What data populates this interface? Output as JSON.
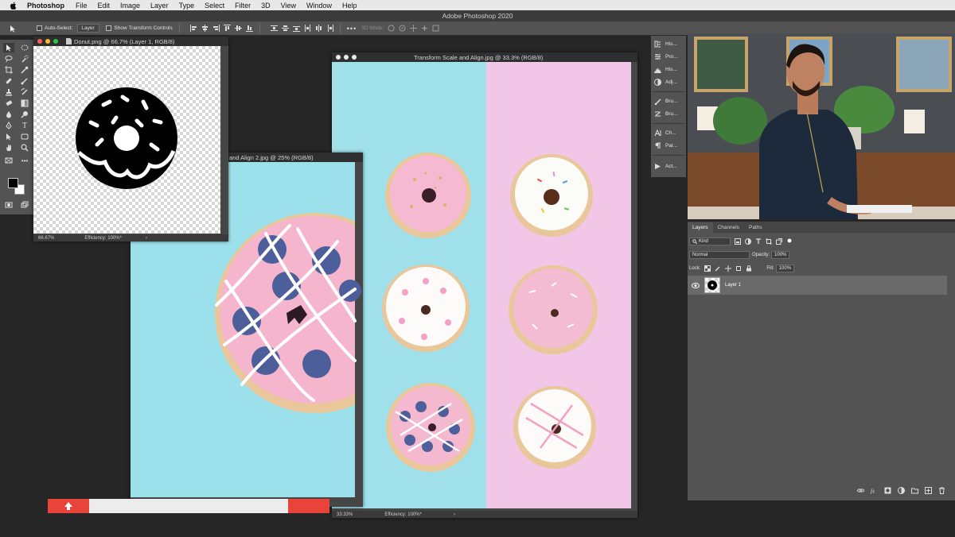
{
  "menubar": {
    "app_name": "Photoshop",
    "items": [
      "File",
      "Edit",
      "Image",
      "Layer",
      "Type",
      "Select",
      "Filter",
      "3D",
      "View",
      "Window",
      "Help"
    ]
  },
  "window_title": "Adobe Photoshop 2020",
  "options_bar": {
    "auto_select_label": "Auto-Select:",
    "auto_select_value": "Layer",
    "transform_controls_label": "Show Transform Controls",
    "threed_mode_label": "3D Mode:"
  },
  "documents": {
    "donut": {
      "title": "Donut.png @ 66.7% (Layer 1, RGB/8)",
      "zoom": "66.67%",
      "efficiency": "Efficiency: 100%*"
    },
    "align2": {
      "title": "and Align 2.jpg @ 25% (RGB/8)"
    },
    "transform": {
      "title": "Transform Scale and Align.jpg @ 33.3% (RGB/8)",
      "zoom": "33.33%",
      "efficiency": "Efficiency: 100%*"
    }
  },
  "mini_panel": {
    "items": [
      {
        "label": "His...",
        "icon": "history-icon"
      },
      {
        "label": "Pro...",
        "icon": "properties-icon"
      },
      {
        "label": "His...",
        "icon": "histogram-icon"
      },
      {
        "label": "Adj...",
        "icon": "adjustments-icon"
      },
      {
        "label": "Bru...",
        "icon": "brush-icon"
      },
      {
        "label": "Bru...",
        "icon": "brush-settings-icon"
      },
      {
        "label": "Ch...",
        "icon": "character-icon"
      },
      {
        "label": "Par...",
        "icon": "paragraph-icon"
      },
      {
        "label": "Act...",
        "icon": "actions-icon"
      }
    ]
  },
  "layers_panel": {
    "tabs": [
      "Layers",
      "Channels",
      "Paths"
    ],
    "kind_label": "Kind",
    "blend_mode": "Normal",
    "opacity_label": "Opacity:",
    "opacity_value": "100%",
    "lock_label": "Lock:",
    "fill_label": "Fill:",
    "fill_value": "100%",
    "layer_name": "Layer 1"
  },
  "colors": {
    "menubar_bg": "#e8e8e8",
    "workspace_bg": "#262626",
    "panel_bg": "#535353",
    "cyan_bg": "#9fe2ec",
    "pink_bg": "#f2c6e6",
    "icing_pink": "#f4b8cf",
    "close_red": "#fd5f57",
    "minimize_yellow": "#fdbc2e",
    "zoom_green": "#2ac840"
  }
}
